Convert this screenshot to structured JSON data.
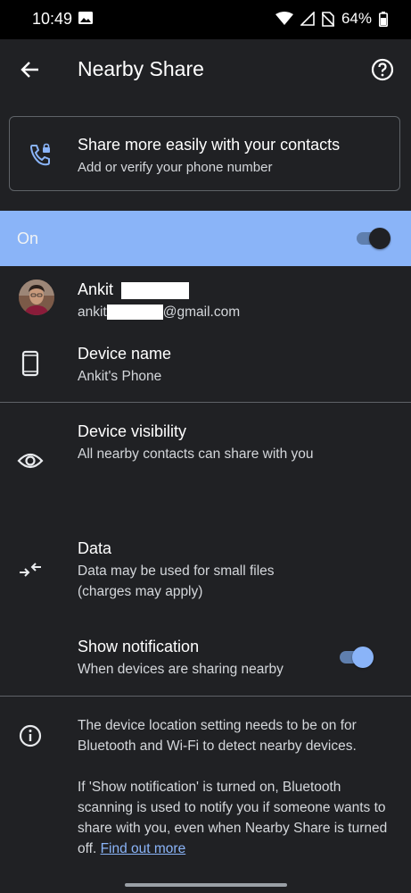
{
  "status_bar": {
    "time": "10:49",
    "battery_percent": "64%",
    "icons": [
      "gallery-icon",
      "wifi-icon",
      "signal-icon",
      "no-sim-icon",
      "battery-icon"
    ]
  },
  "app_bar": {
    "title": "Nearby Share",
    "back_icon": "back-arrow-icon",
    "help_icon": "help-icon"
  },
  "contact_card": {
    "title": "Share more easily with your contacts",
    "subtitle": "Add or verify your phone number",
    "icon": "phone-lock-icon"
  },
  "main_toggle": {
    "label": "On",
    "checked": true
  },
  "account": {
    "name_prefix": "Ankit",
    "email_prefix": "ankit",
    "email_suffix": "@gmail.com"
  },
  "device_name": {
    "label": "Device name",
    "value": "Ankit's Phone",
    "icon": "phone-icon"
  },
  "device_visibility": {
    "label": "Device visibility",
    "value": "All nearby contacts can share with you",
    "icon": "eye-icon"
  },
  "data": {
    "label": "Data",
    "value_line1": "Data may be used for small files",
    "value_line2": "(charges may apply)",
    "icon": "data-arrows-icon"
  },
  "show_notification": {
    "label": "Show notification",
    "value": "When devices are sharing nearby",
    "checked": true
  },
  "info": {
    "icon": "info-icon",
    "paragraph1": "The device location setting needs to be on for Bluetooth and Wi-Fi to detect nearby devices.",
    "paragraph2": "If 'Show notification' is turned on, Bluetooth scanning is used to notify you if someone wants to share with you, even when Nearby Share is turned off.",
    "link_text": "Find out more"
  },
  "colors": {
    "background": "#202124",
    "accent": "#8ab4f8",
    "divider": "#5f6368"
  }
}
